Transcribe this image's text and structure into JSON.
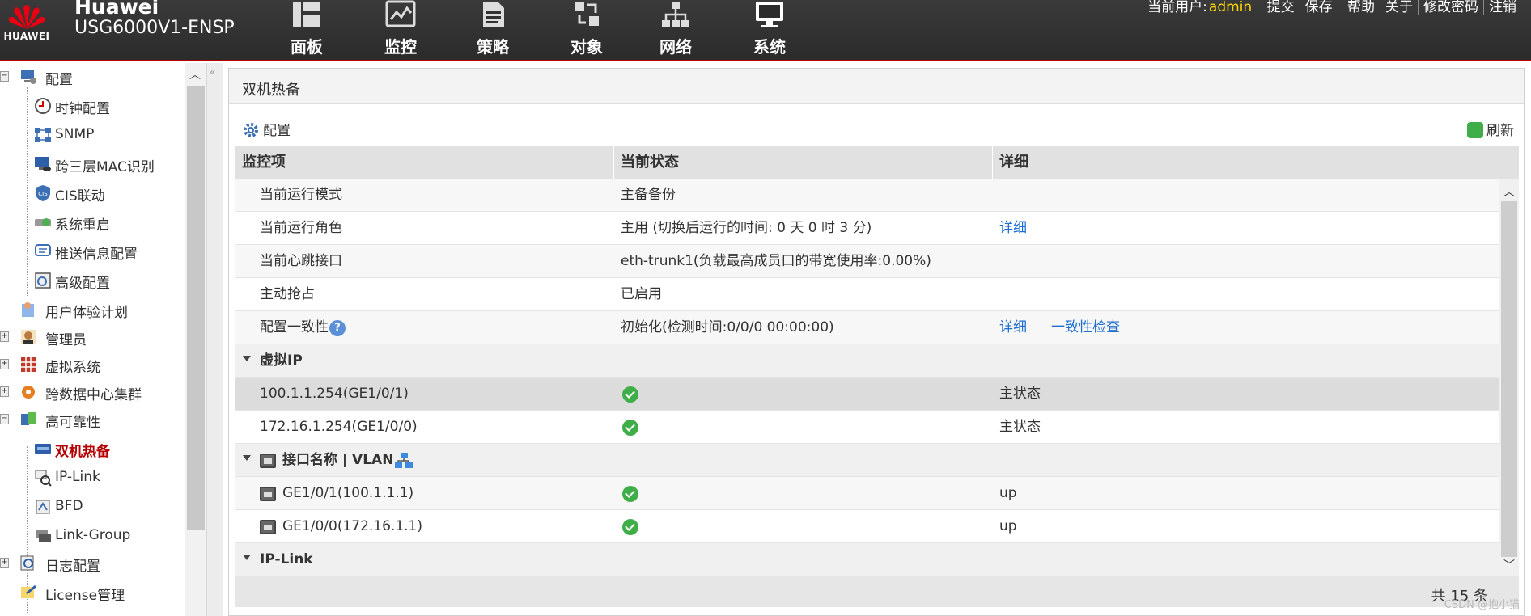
{
  "header": {
    "logo_text": "HUAWEI",
    "brand": "Huawei",
    "model": "USG6000V1-ENSP",
    "accent_color": "#b40000",
    "nav": [
      {
        "label": "面板",
        "icon": "dashboard-icon"
      },
      {
        "label": "监控",
        "icon": "monitor-chart-icon"
      },
      {
        "label": "策略",
        "icon": "policy-document-icon"
      },
      {
        "label": "对象",
        "icon": "object-icon"
      },
      {
        "label": "网络",
        "icon": "network-topology-icon"
      },
      {
        "label": "系统",
        "icon": "system-monitor-icon"
      }
    ],
    "user_prefix": "当前用户:",
    "username": "admin",
    "links": [
      "提交",
      "保存",
      "帮助",
      "关于",
      "修改密码",
      "注销"
    ]
  },
  "sidebar": {
    "items": [
      {
        "label": "配置",
        "level": 0,
        "toggle": "-"
      },
      {
        "label": "时钟配置",
        "level": 1
      },
      {
        "label": "SNMP",
        "level": 1
      },
      {
        "label": "跨三层MAC识别",
        "level": 1
      },
      {
        "label": "CIS联动",
        "level": 1
      },
      {
        "label": "系统重启",
        "level": 1
      },
      {
        "label": "推送信息配置",
        "level": 1
      },
      {
        "label": "高级配置",
        "level": 1
      },
      {
        "label": "用户体验计划",
        "level": 0,
        "toggle": ""
      },
      {
        "label": "管理员",
        "level": 0,
        "toggle": "+"
      },
      {
        "label": "虚拟系统",
        "level": 0,
        "toggle": "+"
      },
      {
        "label": "跨数据中心集群",
        "level": 0,
        "toggle": "+"
      },
      {
        "label": "高可靠性",
        "level": 0,
        "toggle": "-"
      },
      {
        "label": "双机热备",
        "level": 1,
        "active": true
      },
      {
        "label": "IP-Link",
        "level": 1
      },
      {
        "label": "BFD",
        "level": 1
      },
      {
        "label": "Link-Group",
        "level": 1
      },
      {
        "label": "日志配置",
        "level": 0,
        "toggle": "+"
      },
      {
        "label": "License管理",
        "level": 0,
        "toggle": ""
      }
    ]
  },
  "panel": {
    "title": "双机热备",
    "config_label": "配置",
    "refresh_label": "刷新"
  },
  "table": {
    "columns": [
      "监控项",
      "当前状态",
      "详细"
    ],
    "rows": [
      {
        "item": "当前运行模式",
        "status": "主备备份",
        "detail": []
      },
      {
        "item": "当前运行角色",
        "status": "主用 (切换后运行的时间: 0 天 0 时 3 分)",
        "detail": [
          "详细"
        ]
      },
      {
        "item": "当前心跳接口",
        "status": "eth-trunk1(负载最高成员口的带宽使用率:0.00%)",
        "detail": []
      },
      {
        "item": "主动抢占",
        "status": "已启用",
        "detail": []
      },
      {
        "item": "配置一致性",
        "help": "?",
        "status": "初始化(检测时间:0/0/0 00:00:00)",
        "detail": [
          "详细",
          "一致性检查"
        ]
      }
    ],
    "groups": [
      {
        "title": "虚拟IP",
        "rows": [
          {
            "item": "100.1.1.254(GE1/0/1)",
            "status_icon": "ok",
            "detail": "主状态"
          },
          {
            "item": "172.16.1.254(GE1/0/0)",
            "status_icon": "ok",
            "detail": "主状态"
          }
        ]
      },
      {
        "title": "接口名称 | VLAN",
        "rows": [
          {
            "item": "GE1/0/1(100.1.1.1)",
            "status_icon": "ok",
            "detail": "up"
          },
          {
            "item": "GE1/0/0(172.16.1.1)",
            "status_icon": "ok",
            "detail": "up"
          }
        ]
      },
      {
        "title": "IP-Link",
        "rows": []
      }
    ],
    "total": "共 15 条"
  },
  "watermark": "CSDN @抱小猫"
}
